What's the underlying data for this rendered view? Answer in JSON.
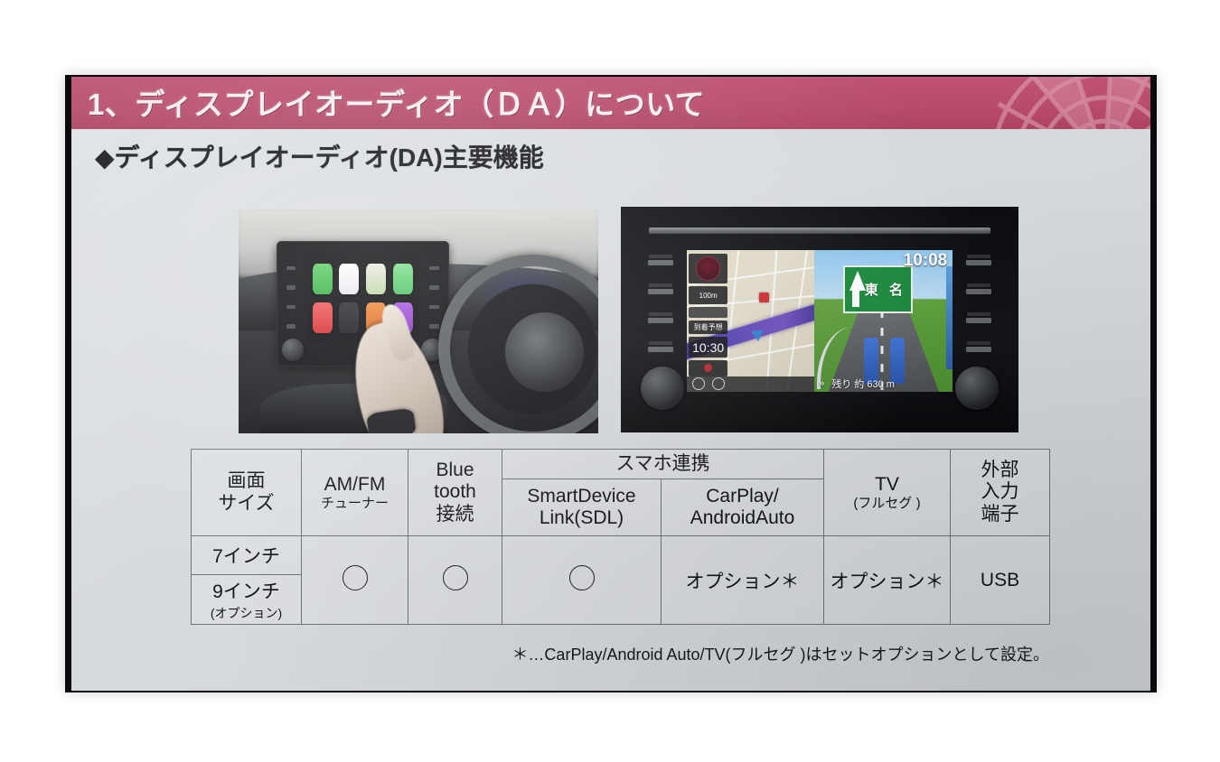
{
  "slide": {
    "title": "1、ディスプレイオーディオ（ＤＡ）について",
    "subtitle": "◆ディスプレイオーディオ(DA)主要機能"
  },
  "photos": {
    "left": {
      "caption": "car-interior-carplay-photo",
      "apps": [
        "phone-app-icon",
        "music-app-icon",
        "maps-app-icon",
        "podcasts-app-icon",
        "youtube-app-icon",
        "music-alt-app-icon",
        "books-app-icon",
        "radio-app-icon"
      ]
    },
    "right": {
      "caption": "navigation-head-unit-photo",
      "clock": "10:08",
      "map_scale": "100m",
      "eta_label": "到着予想",
      "eta_time": "10:30",
      "sign_text": "東 名",
      "distance_text": "残り 約 630 m"
    }
  },
  "table": {
    "headers": {
      "screen_size": "画面\nサイズ",
      "screen_size_line1": "画面",
      "screen_size_line2": "サイズ",
      "amfm_line1": "AM/FM",
      "amfm_line2": "チューナー",
      "bluetooth_line1": "Blue",
      "bluetooth_line2": "tooth",
      "bluetooth_line3": "接続",
      "smartphone_group": "スマホ連携",
      "sdl_line1": "SmartDevice",
      "sdl_line2": "Link(SDL)",
      "carplay_line1": "CarPlay/",
      "carplay_line2": "AndroidAuto",
      "tv_line1": "TV",
      "tv_line2": "(フルセグ )",
      "external_line1": "外部",
      "external_line2": "入力",
      "external_line3": "端子"
    },
    "rows": {
      "size_7": "7インチ",
      "size_9_main": "9インチ",
      "size_9_sub": "(オプション)",
      "amfm_value": "○",
      "bluetooth_value": "○",
      "sdl_value": "○",
      "carplay_value": "オプション＊",
      "tv_value": "オプション＊",
      "external_value": "USB"
    }
  },
  "footnote": "＊…CarPlay/Android Auto/TV(フルセグ )はセットオプションとして設定。",
  "colors": {
    "title_bar_pink": "#b84c6c",
    "slide_background": "#d8dbdf",
    "table_border": "#707478",
    "text_dark": "#141519"
  }
}
